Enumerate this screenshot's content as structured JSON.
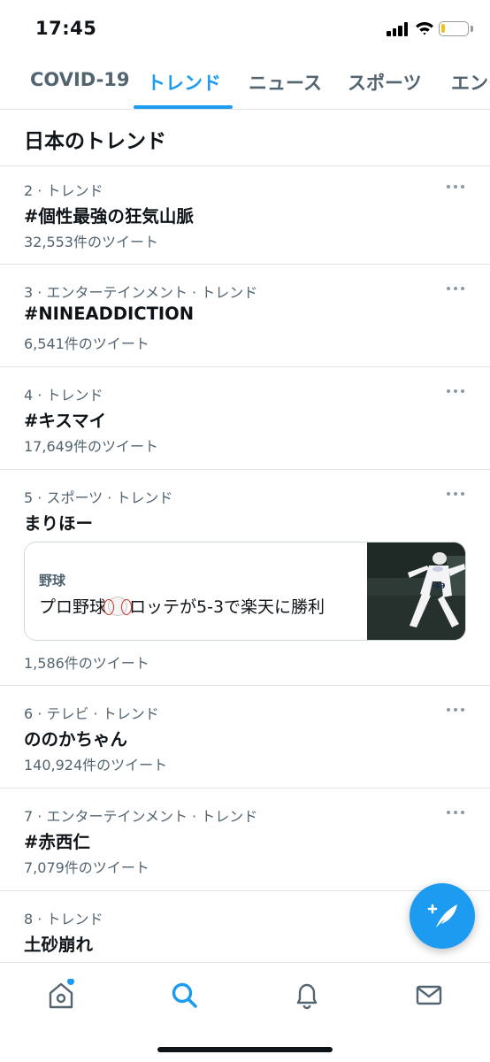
{
  "status_bar": {
    "time": "17:45",
    "battery_level": 0.15,
    "battery_color": "#f2c21b"
  },
  "tabs": [
    {
      "label": "COVID-19",
      "active": false
    },
    {
      "label": "トレンド",
      "active": true
    },
    {
      "label": "ニュース",
      "active": false
    },
    {
      "label": "スポーツ",
      "active": false
    },
    {
      "label": "エンタ",
      "active": false
    }
  ],
  "section": {
    "title": "日本のトレンド"
  },
  "trends": [
    {
      "meta": "2 · トレンド",
      "name": "#個性最強の狂気山脈",
      "count": "32,553件のツイート"
    },
    {
      "meta": "3 · エンターテインメント · トレンド",
      "name": "#NINEADDICTION",
      "count": "6,541件のツイート"
    },
    {
      "meta": "4 · トレンド",
      "name": "#キスマイ",
      "count": "17,649件のツイート"
    },
    {
      "meta": "5 · スポーツ · トレンド",
      "name": "まりほー",
      "count": "1,586件のツイート",
      "card": {
        "category": "野球",
        "title_before": "プロ野球",
        "title_after": "ロッテが5-3で楽天に勝利",
        "thumb_icon": "baseball-pitcher-photo"
      }
    },
    {
      "meta": "6 · テレビ · トレンド",
      "name": "ののかちゃん",
      "count": "140,924件のツイート"
    },
    {
      "meta": "7 · エンターテインメント · トレンド",
      "name": "#赤西仁",
      "count": "7,079件のツイート"
    },
    {
      "meta": "8 · トレンド",
      "name": "土砂崩れ",
      "count": ""
    }
  ],
  "fab": {
    "icon": "compose-tweet-icon",
    "color": "#1d9bf0"
  },
  "bottom_nav": [
    {
      "name": "home",
      "icon": "home-icon",
      "active": false,
      "has_notification_dot": true
    },
    {
      "name": "search",
      "icon": "search-icon",
      "active": true
    },
    {
      "name": "notifications",
      "icon": "bell-icon",
      "active": false
    },
    {
      "name": "messages",
      "icon": "mail-icon",
      "active": false
    }
  ],
  "colors": {
    "accent": "#1d9bf0",
    "text_primary": "#0f1419",
    "text_secondary": "#536471",
    "divider": "#e1e4e6"
  }
}
